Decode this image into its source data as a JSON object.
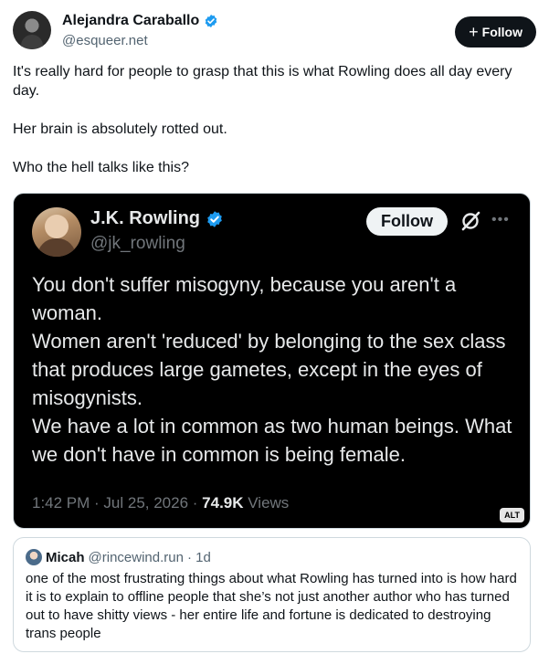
{
  "author": {
    "display_name": "Alejandra Caraballo",
    "handle": "@esqueer.net",
    "verified": true,
    "follow_label": "Follow"
  },
  "tweet": {
    "paragraphs": [
      "It's really hard for people to grasp that this is what Rowling does all day every day.",
      "Her brain is absolutely rotted out.",
      "Who the hell talks like this?"
    ]
  },
  "embedded_image": {
    "display_name": "J.K. Rowling",
    "handle": "@jk_rowling",
    "verified": true,
    "follow_label": "Follow",
    "more_label": "•••",
    "lines": [
      "You don't suffer misogyny, because you aren't a woman.",
      "Women aren't 'reduced' by belonging to the sex class that produces large gametes, except in the eyes of misogynists.",
      "We have a lot in common as two human beings. What we don't have in common is being female."
    ],
    "timestamp": "1:42 PM · Jul 25, 2026 · ",
    "views_count": "74.9K",
    "views_label": " Views",
    "alt_badge": "ALT"
  },
  "quoted": {
    "display_name": "Micah",
    "handle": "@rincewind.run",
    "age": "· 1d",
    "text": "one of the most frustrating things about what Rowling has turned into is how hard it is to explain to offline people that she’s not just another author who has turned out to have shitty views - her entire life and fortune is dedicated to destroying trans people"
  },
  "colors": {
    "verified_blue": "#1d9bf0",
    "text_primary": "#0f1419",
    "text_secondary": "#536471",
    "image_background": "#000000"
  }
}
